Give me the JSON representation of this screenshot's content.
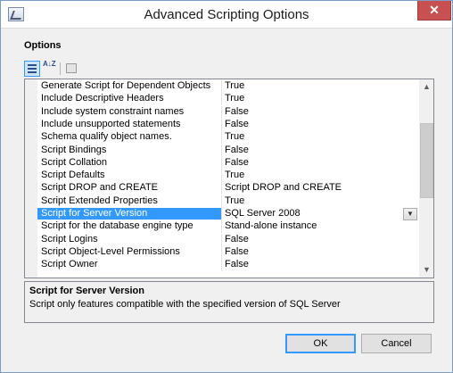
{
  "window": {
    "title": "Advanced Scripting Options",
    "close_glyph": "✕"
  },
  "options_label": "Options",
  "toolbar": {
    "categorized": "categorized-view-icon",
    "alphabetical": "alphabetical-sort-icon",
    "alphabetical_glyph": "A↓Z",
    "property_pages": "property-pages-icon"
  },
  "properties": [
    {
      "name": "Generate Script for Dependent Objects",
      "value": "True"
    },
    {
      "name": "Include Descriptive Headers",
      "value": "True"
    },
    {
      "name": "Include system constraint names",
      "value": "False"
    },
    {
      "name": "Include unsupported statements",
      "value": "False"
    },
    {
      "name": "Schema qualify object names.",
      "value": "True"
    },
    {
      "name": "Script Bindings",
      "value": "False"
    },
    {
      "name": "Script Collation",
      "value": "False"
    },
    {
      "name": "Script Defaults",
      "value": "True"
    },
    {
      "name": "Script DROP and CREATE",
      "value": "Script DROP and CREATE"
    },
    {
      "name": "Script Extended Properties",
      "value": "True"
    },
    {
      "name": "Script for Server Version",
      "value": "SQL Server 2008",
      "selected": true
    },
    {
      "name": "Script for the database engine type",
      "value": "Stand-alone instance"
    },
    {
      "name": "Script Logins",
      "value": "False"
    },
    {
      "name": "Script Object-Level Permissions",
      "value": "False"
    },
    {
      "name": "Script Owner",
      "value": "False"
    }
  ],
  "dropdown_glyph": "▼",
  "scroll": {
    "up_glyph": "▲",
    "down_glyph": "▼"
  },
  "help": {
    "title": "Script for Server Version",
    "description": "Script only features compatible with the specified version of SQL Server"
  },
  "buttons": {
    "ok": "OK",
    "cancel": "Cancel"
  },
  "colors": {
    "selection": "#3399ff",
    "close_button": "#c75050"
  }
}
